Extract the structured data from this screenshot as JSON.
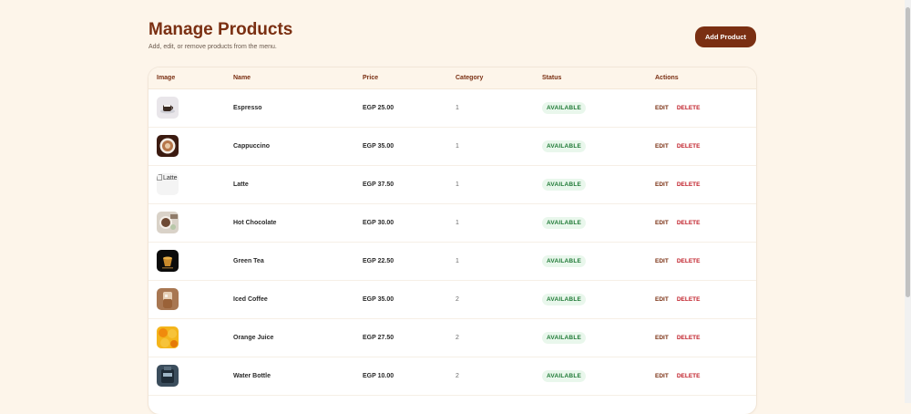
{
  "header": {
    "title": "Manage Products",
    "subtitle": "Add, edit, or remove products from the menu.",
    "add_label": "Add Product"
  },
  "table": {
    "columns": [
      "Image",
      "Name",
      "Price",
      "Category",
      "Status",
      "Actions"
    ],
    "rows": [
      {
        "name": "Espresso",
        "price": "EGP 25.00",
        "category": "1",
        "status": "AVAILABLE"
      },
      {
        "name": "Cappuccino",
        "price": "EGP 35.00",
        "category": "1",
        "status": "AVAILABLE"
      },
      {
        "name": "Latte",
        "price": "EGP 37.50",
        "category": "1",
        "status": "AVAILABLE",
        "image_alt": "Latte"
      },
      {
        "name": "Hot Chocolate",
        "price": "EGP 30.00",
        "category": "1",
        "status": "AVAILABLE"
      },
      {
        "name": "Green Tea",
        "price": "EGP 22.50",
        "category": "1",
        "status": "AVAILABLE"
      },
      {
        "name": "Iced Coffee",
        "price": "EGP 35.00",
        "category": "2",
        "status": "AVAILABLE"
      },
      {
        "name": "Orange Juice",
        "price": "EGP 27.50",
        "category": "2",
        "status": "AVAILABLE"
      },
      {
        "name": "Water Bottle",
        "price": "EGP 10.00",
        "category": "2",
        "status": "AVAILABLE"
      }
    ],
    "actions": {
      "edit": "EDIT",
      "delete": "DELETE"
    }
  },
  "colors": {
    "accent": "#7a2f12",
    "background": "#fdf5ea",
    "available_text": "#1f7a36",
    "available_bg": "#e9f7ec",
    "delete": "#c0202a"
  }
}
